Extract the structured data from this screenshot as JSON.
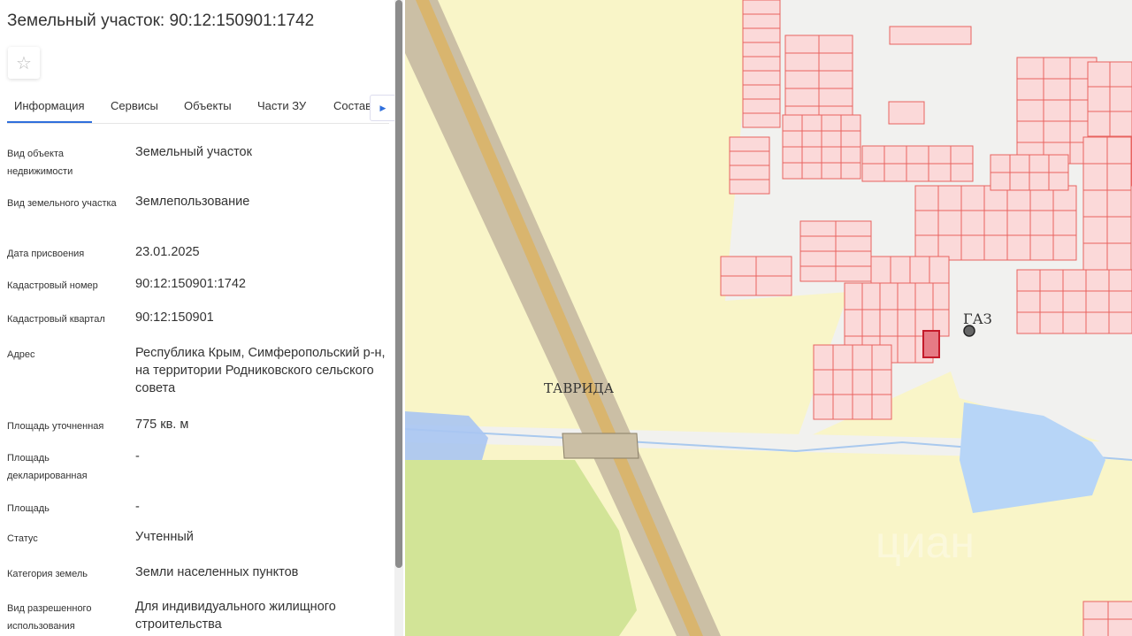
{
  "title": "Земельный участок: 90:12:150901:1742",
  "tabs": [
    "Информация",
    "Сервисы",
    "Объекты",
    "Части ЗУ",
    "Состав"
  ],
  "fields": [
    {
      "label": "Вид объекта недвижимости",
      "value": "Земельный участок"
    },
    {
      "label": "Вид земельного участка",
      "value": "Землепользование"
    },
    {
      "label": "Дата присвоения",
      "value": "23.01.2025"
    },
    {
      "label": "Кадастровый номер",
      "value": "90:12:150901:1742"
    },
    {
      "label": "Кадастровый квартал",
      "value": "90:12:150901"
    },
    {
      "label": "Адрес",
      "value": "Республика Крым, Симферопольский р-н, на территории Родниковского сельского совета"
    },
    {
      "label": "Площадь уточненная",
      "value": "775 кв. м"
    },
    {
      "label": "Площадь декларированная",
      "value": "-"
    },
    {
      "label": "Площадь",
      "value": "-"
    },
    {
      "label": "Статус",
      "value": "Учтенный"
    },
    {
      "label": "Категория земель",
      "value": "Земли населенных пунктов"
    },
    {
      "label": "Вид разрешенного использования",
      "value": "Для индивидуального жилищного строительства"
    }
  ],
  "map": {
    "road_label": "ТАВРИДА",
    "gas_label": "ГАЗ",
    "watermark": "циан"
  }
}
